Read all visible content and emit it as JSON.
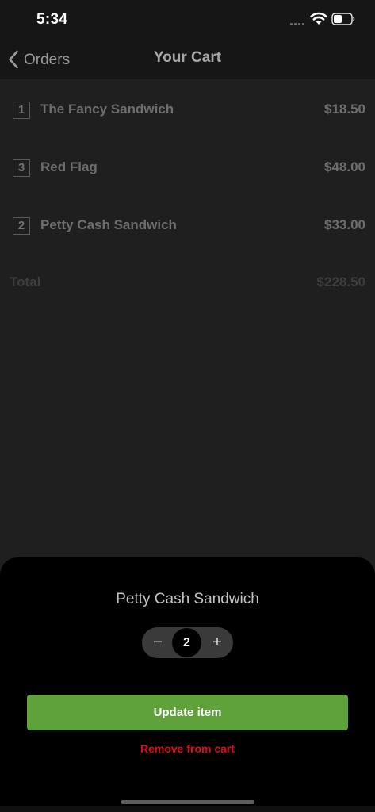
{
  "status_bar": {
    "time": "5:34"
  },
  "nav": {
    "back_label": "Orders",
    "title": "Your Cart"
  },
  "cart": {
    "items": [
      {
        "qty": "1",
        "name": "The Fancy Sandwich",
        "price": "$18.50"
      },
      {
        "qty": "3",
        "name": "Red Flag",
        "price": "$48.00"
      },
      {
        "qty": "2",
        "name": "Petty Cash Sandwich",
        "price": "$33.00"
      }
    ],
    "total_label": "Total",
    "total_value": "$228.50"
  },
  "sheet": {
    "title": "Petty Cash Sandwich",
    "stepper": {
      "minus": "−",
      "value": "2",
      "plus": "+"
    },
    "update_label": "Update item",
    "remove_label": "Remove from cart"
  },
  "colors": {
    "accent_green": "#5fa23a",
    "destructive_red": "#e00b17",
    "background": "#1f1f1f",
    "sheet_background": "#000000"
  },
  "icons": {
    "back": "chevron-left-icon",
    "signal": "cellular-signal-icon",
    "wifi": "wifi-icon",
    "battery": "battery-icon"
  }
}
